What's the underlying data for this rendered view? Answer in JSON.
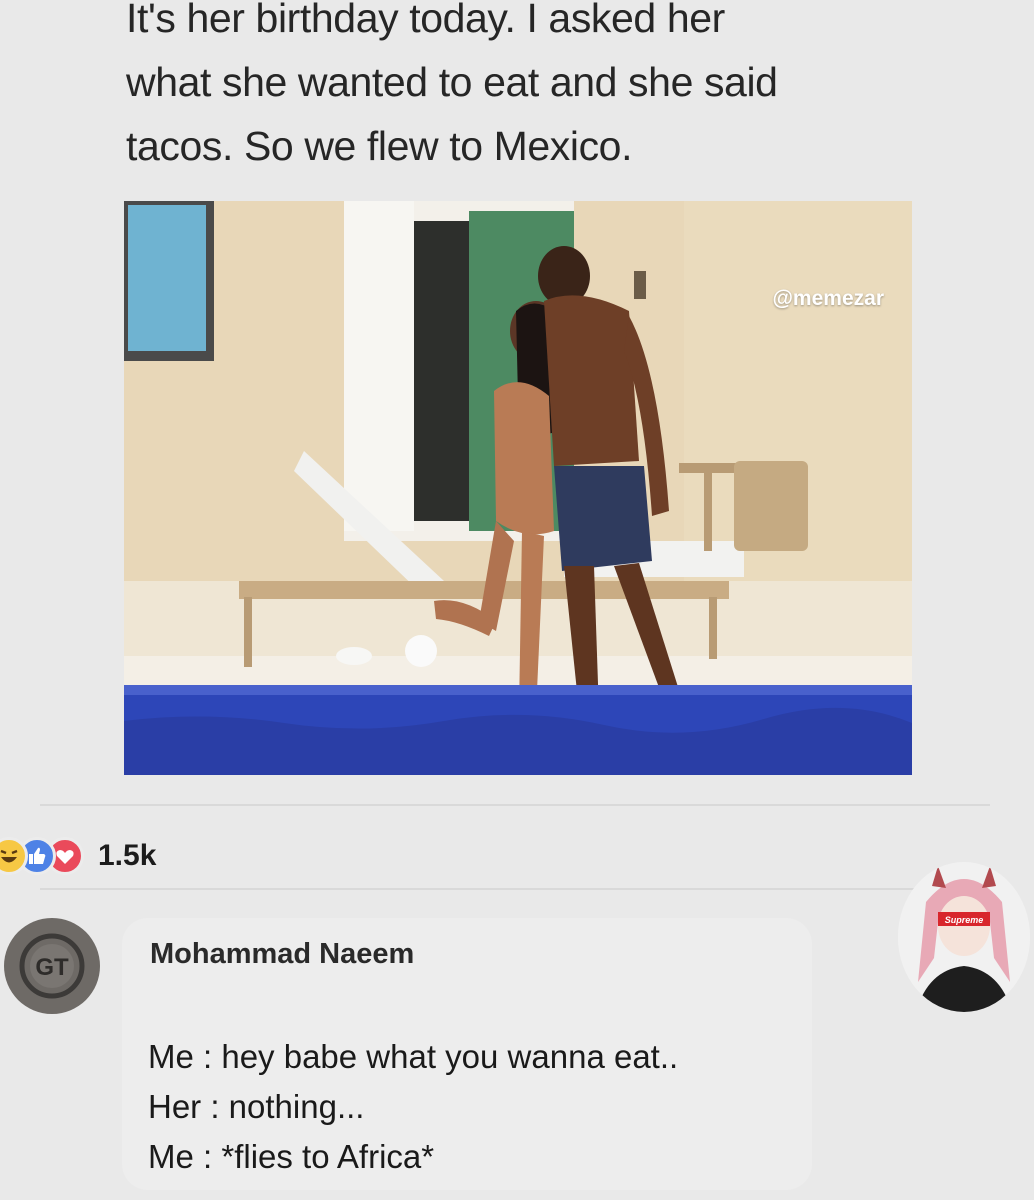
{
  "post": {
    "text_lines": [
      "It's her birthday today. I asked her",
      "what she wanted to eat and she said",
      "tacos. So we flew to Mexico."
    ],
    "image_watermark": "@memezar"
  },
  "reactions": {
    "icons": [
      "haha-icon",
      "like-icon",
      "love-icon"
    ],
    "count": "1.5k"
  },
  "comment": {
    "author": "Mohammad Naeem",
    "lines": [
      "Me : hey babe what you wanna eat..",
      "Her : nothing...",
      "Me : *flies to Africa*"
    ],
    "avatar_left_initials": "GT",
    "avatar_right_badge": "Supreme"
  },
  "colors": {
    "background": "#e9e9e9",
    "bubble": "#ededed",
    "haha": "#f7c844",
    "like": "#4e82e6",
    "love": "#ea4a5b",
    "pool": "#2d46b8"
  }
}
